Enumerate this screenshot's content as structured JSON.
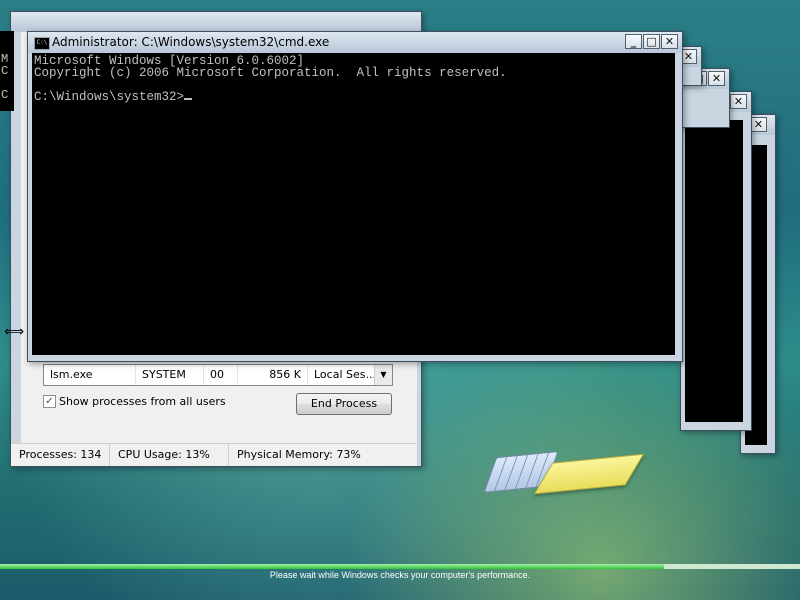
{
  "main_console": {
    "title": "Administrator: C:\\Windows\\system32\\cmd.exe",
    "icon_text": "C:\\",
    "lines": [
      "Microsoft Windows [Version 6.0.6002]",
      "Copyright (c) 2006 Microsoft Corporation.  All rights reserved.",
      "",
      "C:\\Windows\\system32>"
    ]
  },
  "window_controls": {
    "minimize": "_",
    "maximize": "□",
    "close": "✕"
  },
  "ghost_console": {
    "line1": "M",
    "line2": "C",
    "line3": "C"
  },
  "task_manager": {
    "process_row": {
      "image_name": "lsm.exe",
      "user": "SYSTEM",
      "cpu": "00",
      "memory": "856 K",
      "description": "Local Ses..."
    },
    "show_all_label": "Show processes from all users",
    "show_all_checked": true,
    "end_process_label": "End Process",
    "status": {
      "processes": "Processes: 134",
      "cpu_usage": "CPU Usage: 13%",
      "physical_memory": "Physical Memory: 73%"
    }
  },
  "performance_check": {
    "message": "Please wait while Windows checks your computer's performance.",
    "progress": 0.83
  },
  "icons": {
    "app_icon": "cmd-icon",
    "cursor": "resize-horizontal-cursor"
  }
}
